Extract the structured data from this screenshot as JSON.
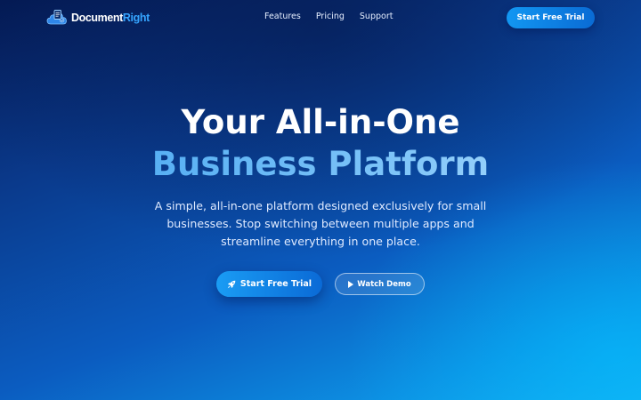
{
  "brand": {
    "name_part1": "Document",
    "name_part2": "Right",
    "logo_icon": "cloud-document-icon"
  },
  "nav": {
    "links": [
      {
        "label": "Features"
      },
      {
        "label": "Pricing"
      },
      {
        "label": "Support"
      }
    ],
    "cta_label": "Start Free Trial"
  },
  "hero": {
    "title_line1": "Your All-in-One",
    "title_line2": "Business Platform",
    "subtitle": "A simple, all-in-one platform designed exclusively for small businesses. Stop switching between multiple apps and streamline everything in one place.",
    "primary_button": {
      "label": "Start Free Trial",
      "icon": "rocket-icon"
    },
    "secondary_button": {
      "label": "Watch Demo",
      "icon": "play-icon"
    }
  },
  "colors": {
    "background_dark": "#041a54",
    "background_light": "#16aef0",
    "accent": "#1297f2",
    "brand_highlight": "#35a4ff"
  }
}
